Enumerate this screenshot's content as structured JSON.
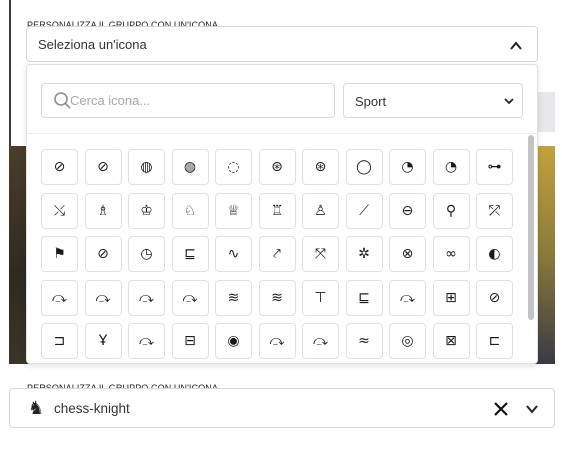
{
  "group_icon_label": "PERSONALIZZA IL GRUPPO CON UN'ICONA",
  "top_select": {
    "value": "Seleziona un'icona",
    "open": true
  },
  "search": {
    "placeholder": "Cerca icona..."
  },
  "category": {
    "selected": "Sport"
  },
  "icons": [
    {
      "name": "ban-ball-icon",
      "glyph": "⊘"
    },
    {
      "name": "football-icon",
      "glyph": "⊘"
    },
    {
      "name": "basketball-icon",
      "glyph": "◍"
    },
    {
      "name": "volleyball-icon",
      "glyph": "◍"
    },
    {
      "name": "golf-ball-icon",
      "glyph": "◌"
    },
    {
      "name": "no-volleyball-icon",
      "glyph": "⊛"
    },
    {
      "name": "soccer-ball-icon",
      "glyph": "⊛"
    },
    {
      "name": "baseball-icon",
      "glyph": "◯"
    },
    {
      "name": "tennis-ball-icon",
      "glyph": "◔"
    },
    {
      "name": "bowling-icon",
      "glyph": "◔"
    },
    {
      "name": "barbell-icon",
      "glyph": "⊶"
    },
    {
      "name": "badminton-icon",
      "glyph": "⤯"
    },
    {
      "name": "chess-bishop-icon",
      "glyph": "♗"
    },
    {
      "name": "chess-king-icon",
      "glyph": "♔"
    },
    {
      "name": "chess-knight-icon",
      "glyph": "♘"
    },
    {
      "name": "chess-queen-icon",
      "glyph": "♕"
    },
    {
      "name": "chess-rook-icon",
      "glyph": "♖"
    },
    {
      "name": "chess-pawn-icon",
      "glyph": "♙"
    },
    {
      "name": "cricket-icon",
      "glyph": "⟋"
    },
    {
      "name": "curling-icon",
      "glyph": "⊖"
    },
    {
      "name": "trophy-icon",
      "glyph": "⚲"
    },
    {
      "name": "skate-icon",
      "glyph": "⤱"
    },
    {
      "name": "golf-flag-icon",
      "glyph": "⚑"
    },
    {
      "name": "ball-off-icon",
      "glyph": "⊘"
    },
    {
      "name": "timer-icon",
      "glyph": "◷"
    },
    {
      "name": "ice-skate-icon",
      "glyph": "⊑"
    },
    {
      "name": "route-icon",
      "glyph": "∿"
    },
    {
      "name": "karate-icon",
      "glyph": "⤤"
    },
    {
      "name": "kayak-icon",
      "glyph": "⤧"
    },
    {
      "name": "puzzle-icon",
      "glyph": "✲"
    },
    {
      "name": "no-kayak-icon",
      "glyph": "⊗"
    },
    {
      "name": "olympics-icon",
      "glyph": "∞"
    },
    {
      "name": "ping-pong-icon",
      "glyph": "◐"
    },
    {
      "name": "run-icon",
      "glyph": "⤼"
    },
    {
      "name": "run-fast-icon",
      "glyph": "⤼"
    },
    {
      "name": "run-sprint-icon",
      "glyph": "⤼"
    },
    {
      "name": "run-dash-icon",
      "glyph": "⤼"
    },
    {
      "name": "swim-off-icon",
      "glyph": "≋"
    },
    {
      "name": "pool-icon",
      "glyph": "≋"
    },
    {
      "name": "weight-bench-icon",
      "glyph": "⊤"
    },
    {
      "name": "roller-skate-icon",
      "glyph": "⊑"
    },
    {
      "name": "rowing-icon",
      "glyph": "⤼"
    },
    {
      "name": "scoreboard-icon",
      "glyph": "⊞"
    },
    {
      "name": "soccer-field-off-icon",
      "glyph": "⊘"
    },
    {
      "name": "skateboard-icon",
      "glyph": "⊐"
    },
    {
      "name": "stretching-icon",
      "glyph": "Ұ"
    },
    {
      "name": "run-track-icon",
      "glyph": "⤼"
    },
    {
      "name": "soccer-field-icon",
      "glyph": "⊟"
    },
    {
      "name": "tennis-ball-alt-icon",
      "glyph": "◉"
    },
    {
      "name": "walk-icon",
      "glyph": "⤼"
    },
    {
      "name": "walk-fast-icon",
      "glyph": "⤼"
    },
    {
      "name": "swim-icon",
      "glyph": "≈"
    },
    {
      "name": "target-arrow-icon",
      "glyph": "◎"
    },
    {
      "name": "tic-tac-toe-icon",
      "glyph": "⊠"
    },
    {
      "name": "tournament-icon",
      "glyph": "⊏"
    }
  ],
  "selected_icon": {
    "name": "chess-knight",
    "glyph": "♞"
  },
  "scroll": {
    "position": 0.0,
    "visible_fraction": 0.81
  }
}
